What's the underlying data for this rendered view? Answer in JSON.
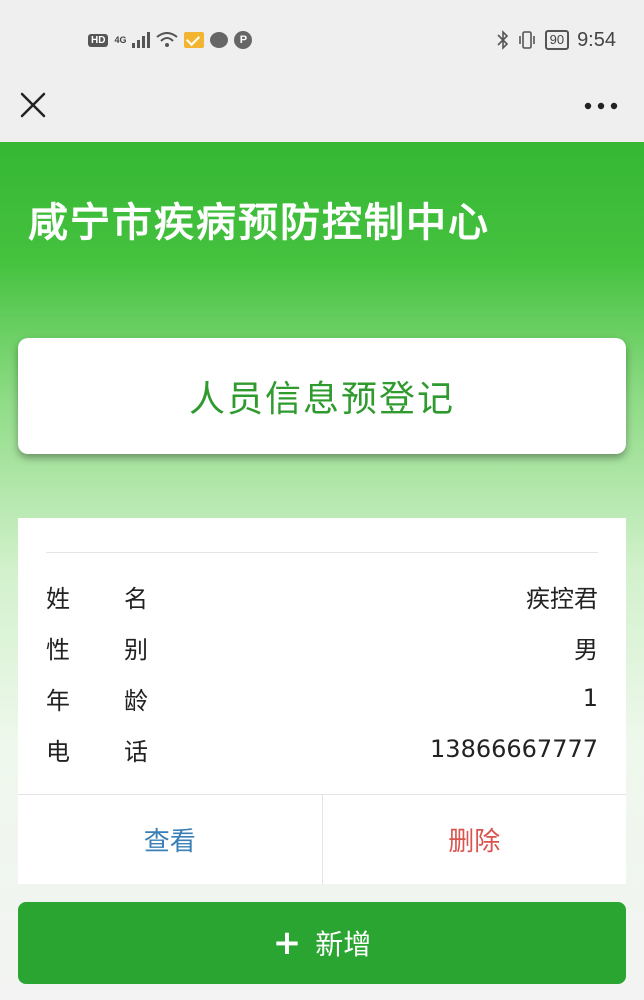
{
  "status_bar": {
    "hd": "HD",
    "network": "4G",
    "p_badge": "P",
    "battery": "90",
    "time": "9:54"
  },
  "navbar": {
    "close_icon": "close-icon",
    "more_icon": "more-options-icon"
  },
  "header": {
    "org_title": "咸宁市疾病预防控制中心"
  },
  "registration": {
    "title": "人员信息预登记"
  },
  "person": {
    "fields": [
      {
        "label_a": "姓",
        "label_b": "名",
        "value": "疾控君"
      },
      {
        "label_a": "性",
        "label_b": "别",
        "value": "男"
      },
      {
        "label_a": "年",
        "label_b": "龄",
        "value": "1"
      },
      {
        "label_a": "电",
        "label_b": "话",
        "value": "13866667777"
      }
    ],
    "view_label": "查看",
    "delete_label": "删除"
  },
  "add_button": {
    "icon": "+",
    "label": "新增"
  },
  "colors": {
    "brand_green": "#35b734",
    "button_green": "#2aa532",
    "view_blue": "#3a7fb6",
    "delete_red": "#d9534f"
  }
}
